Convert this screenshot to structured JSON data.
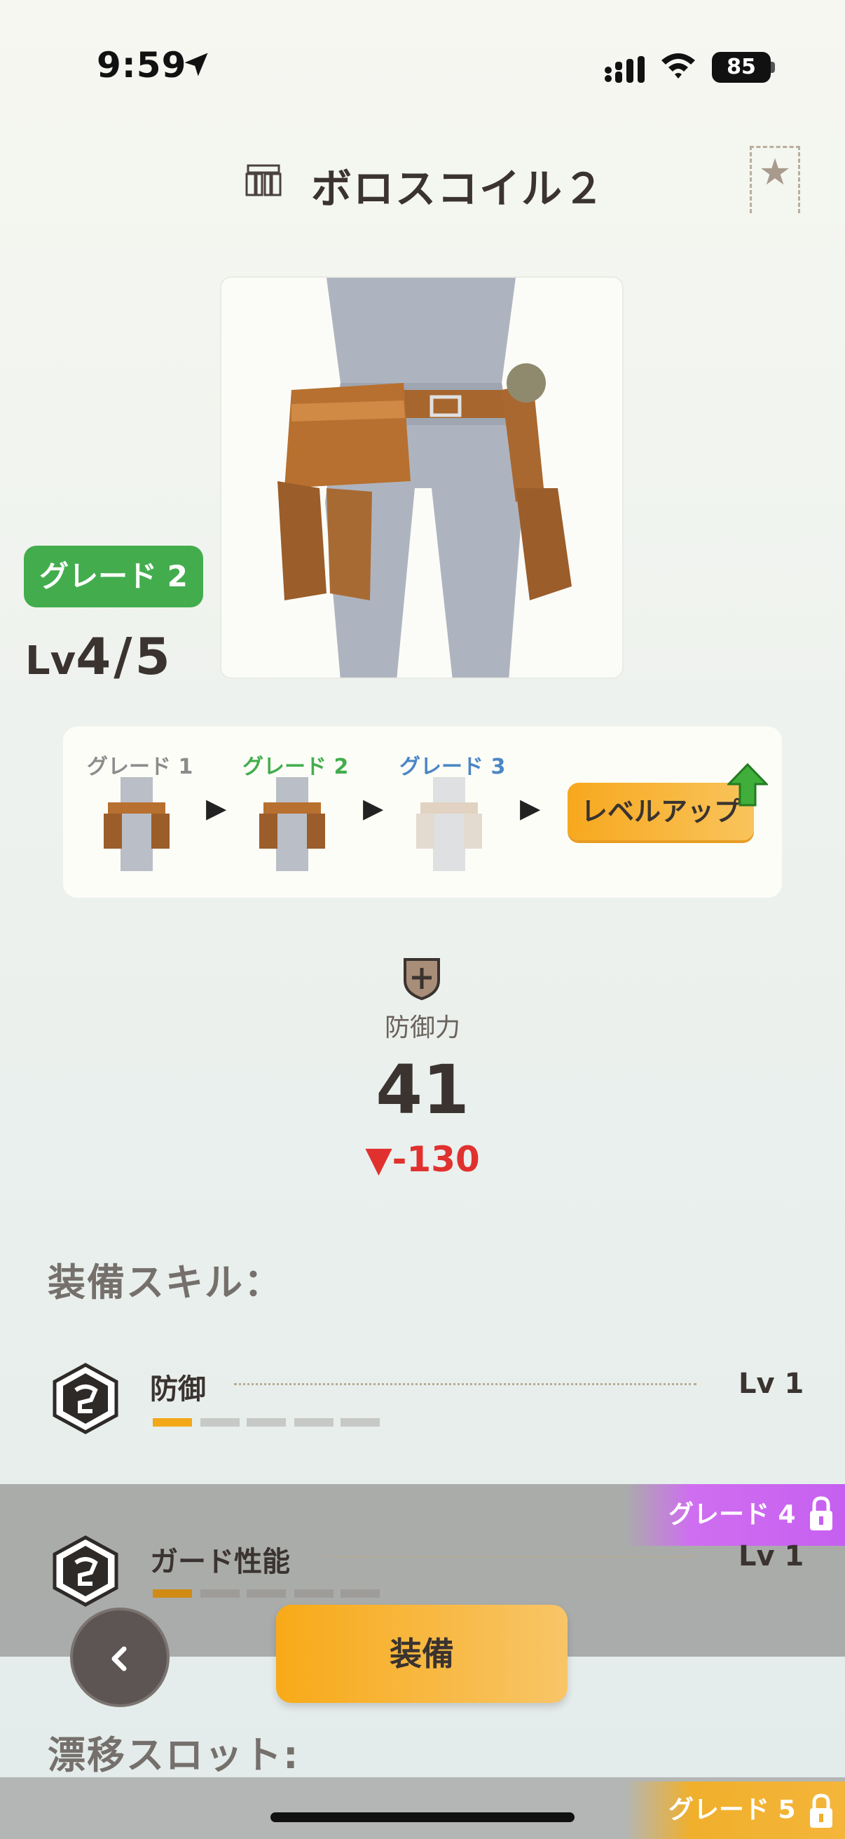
{
  "status_bar": {
    "time": "9:59",
    "battery": "85"
  },
  "header": {
    "title": "ボロスコイル２"
  },
  "equipment": {
    "grade_badge": "グレード 2",
    "level_prefix": "Lv",
    "level_value": "4/5"
  },
  "grade_panel": {
    "grades": [
      {
        "label": "グレード 1",
        "color": "#8c8c8c"
      },
      {
        "label": "グレード 2",
        "color": "#43ad4d"
      },
      {
        "label": "グレード 3",
        "color": "#4b86c5"
      }
    ],
    "level_up_label": "レベルアップ"
  },
  "defense": {
    "label": "防御力",
    "value": "41",
    "diff": "▼-130"
  },
  "skills": {
    "section_title": "装備スキル：",
    "items": [
      {
        "name": "防御",
        "level": "Lv 1",
        "filled": 1,
        "total": 5
      },
      {
        "name": "ガード性能",
        "level": "Lv 1",
        "filled": 1,
        "total": 5
      }
    ],
    "lock_label": "グレード 4"
  },
  "actions": {
    "back_icon": "chevron-left",
    "equip_label": "装備"
  },
  "slots": {
    "section_title": "漂移スロット:",
    "lock_label": "グレード 5"
  },
  "colors": {
    "accent_orange": "#f8aa18",
    "grade_green": "#43ad4d",
    "lock_purple": "#c65ff0",
    "diff_red": "#e0312f"
  }
}
